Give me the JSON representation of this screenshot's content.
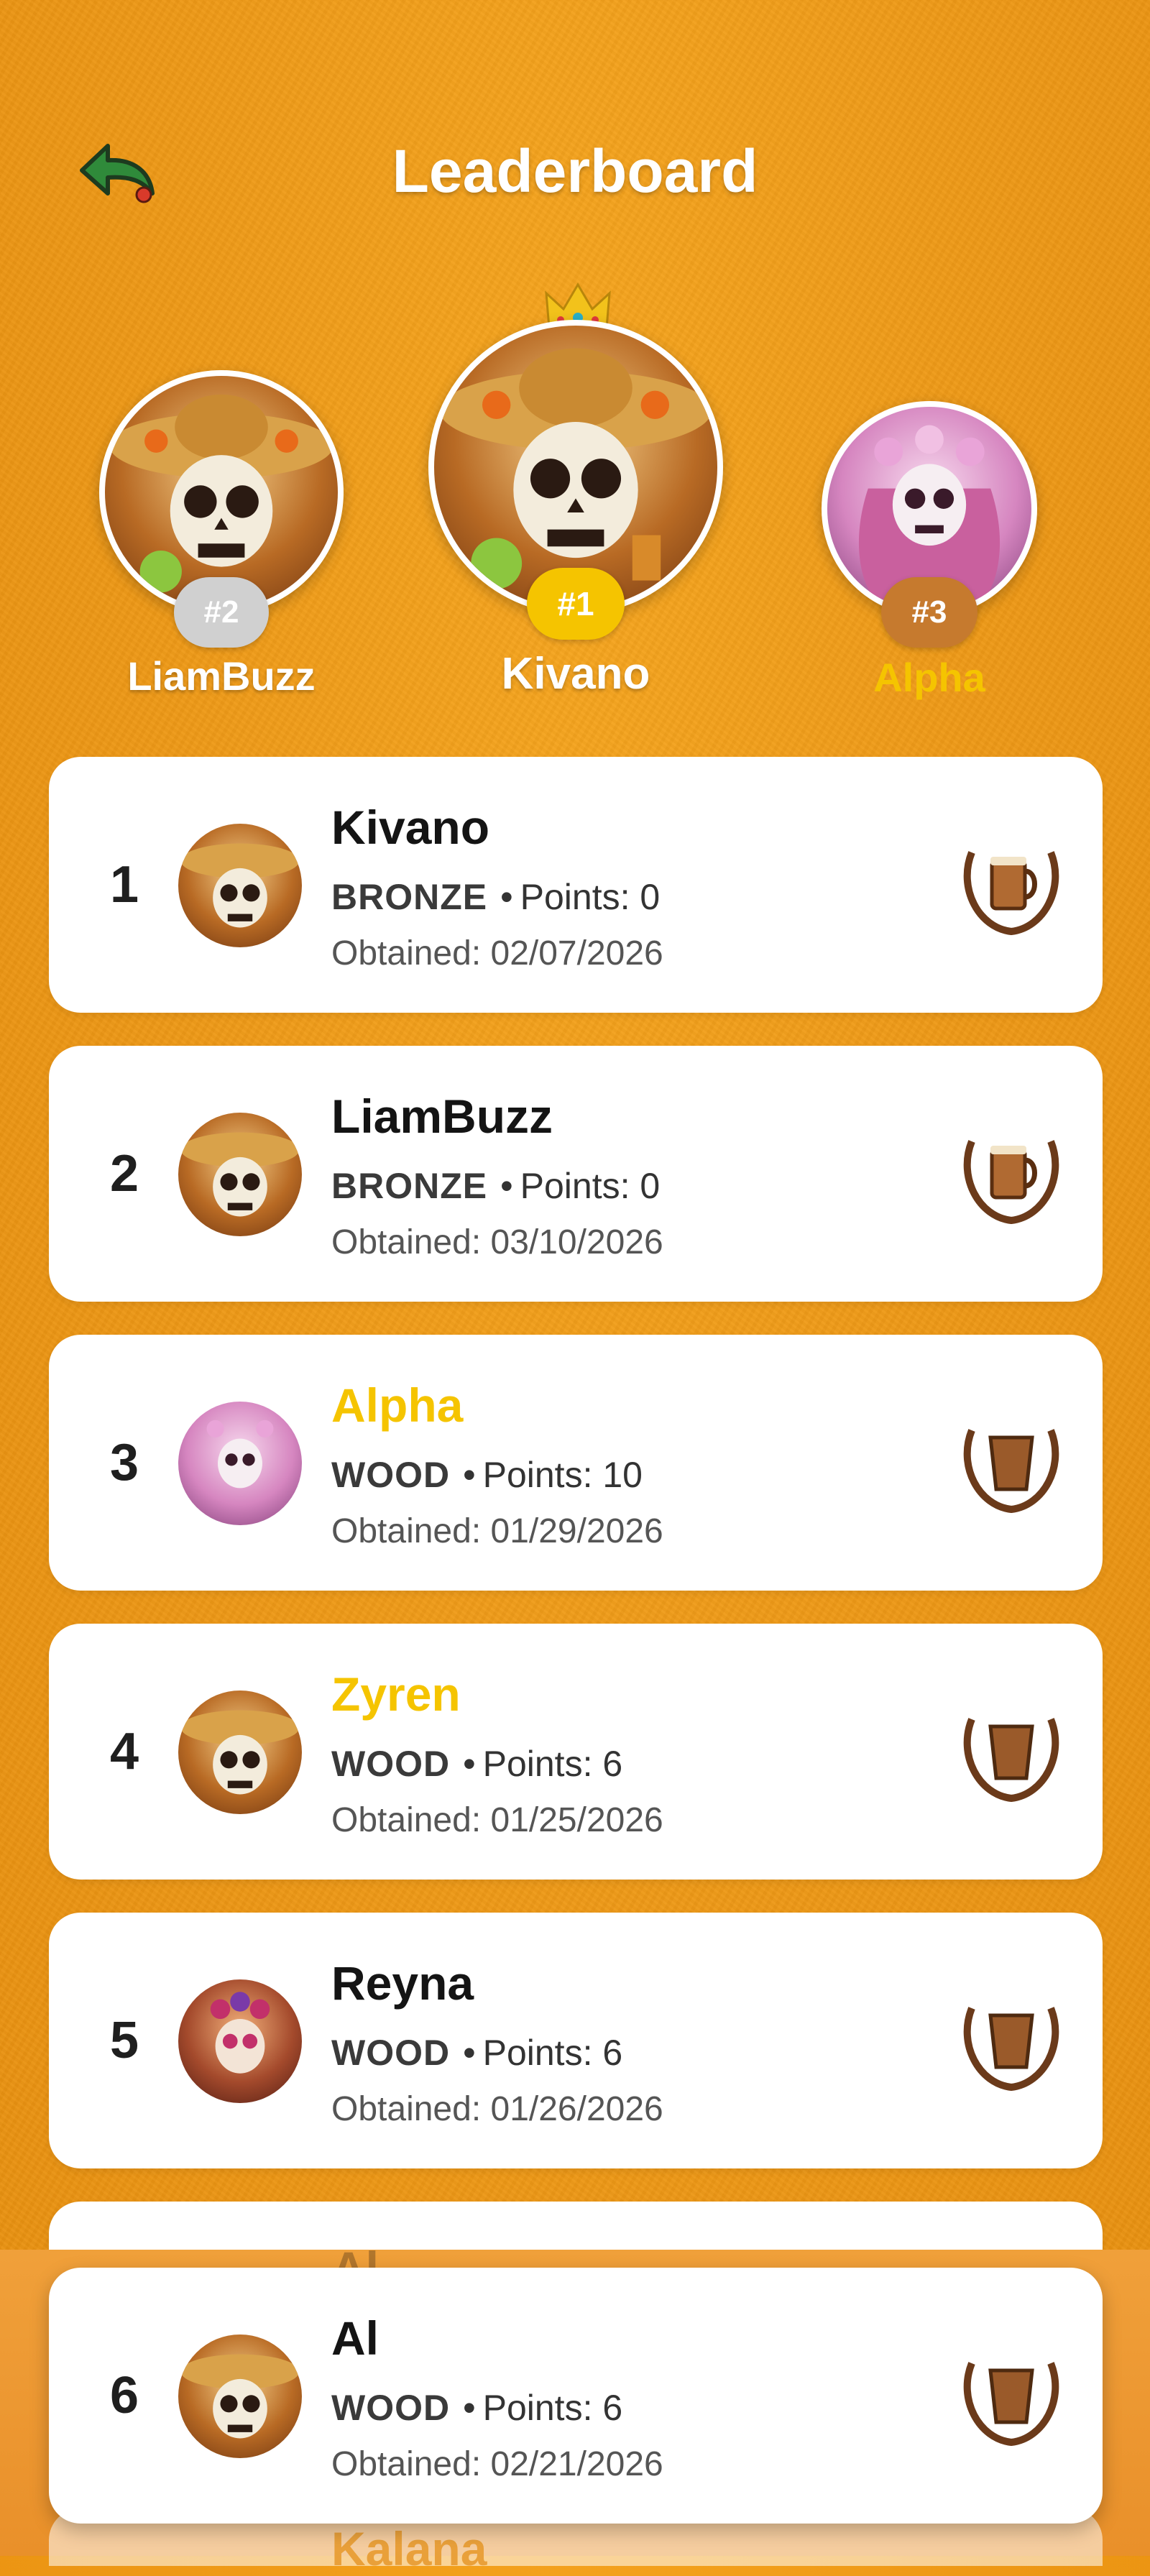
{
  "header": {
    "title": "Leaderboard",
    "back_icon": "back-arrow-icon"
  },
  "podium": {
    "second": {
      "badge": "#2",
      "name": "LiamBuzz",
      "badge_color": "#cfcfcf"
    },
    "first": {
      "badge": "#1",
      "name": "Kivano",
      "badge_color": "#f5c400"
    },
    "third": {
      "badge": "#3",
      "name": "Alpha",
      "badge_color": "#c67a2e",
      "name_color": "#f5c400"
    }
  },
  "leaderboard": {
    "points_label": "Points:",
    "obtained_label": "Obtained:",
    "rows": [
      {
        "rank": "1",
        "name": "Kivano",
        "tier": "BRONZE",
        "points": "0",
        "obtained": "02/07/2026",
        "avatar": "skull-sombrero",
        "trophy": "bronze-mug-icon"
      },
      {
        "rank": "2",
        "name": "LiamBuzz",
        "tier": "BRONZE",
        "points": "0",
        "obtained": "03/10/2026",
        "avatar": "skull-sombrero",
        "trophy": "bronze-mug-icon"
      },
      {
        "rank": "3",
        "name": "Alpha",
        "tier": "WOOD",
        "points": "10",
        "obtained": "01/29/2026",
        "avatar": "fairy-skull",
        "trophy": "wood-cup-icon",
        "highlight": true
      },
      {
        "rank": "4",
        "name": "Zyren",
        "tier": "WOOD",
        "points": "6",
        "obtained": "01/25/2026",
        "avatar": "skull-sombrero",
        "trophy": "wood-cup-icon",
        "highlight": true
      },
      {
        "rank": "5",
        "name": "Reyna",
        "tier": "WOOD",
        "points": "6",
        "obtained": "01/26/2026",
        "avatar": "rose-skull",
        "trophy": "wood-cup-icon"
      }
    ],
    "peek_above_sticky": "Al",
    "peek_below_sticky": "Kalana"
  },
  "current_user": {
    "rank": "6",
    "name": "Al",
    "tier": "WOOD",
    "points": "6",
    "obtained": "02/21/2026",
    "avatar": "skull-sombrero",
    "trophy": "wood-cup-icon"
  },
  "colors": {
    "background": "#ef9a17",
    "card": "#ffffff",
    "gold_text": "#f5c400"
  }
}
